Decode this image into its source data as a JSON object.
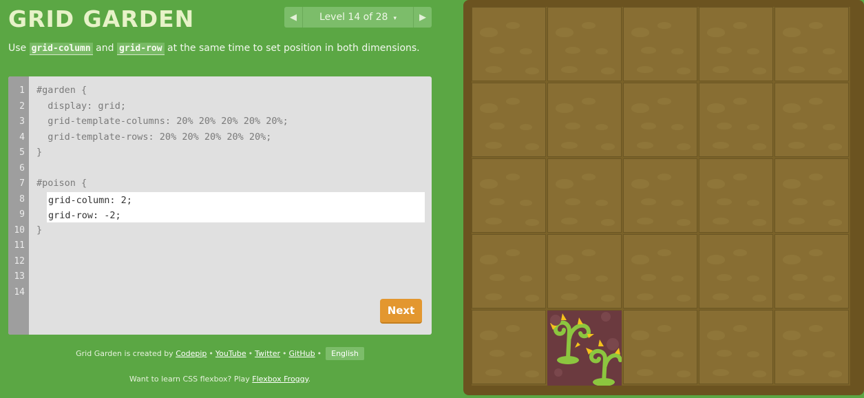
{
  "app": {
    "title": "GRID GARDEN"
  },
  "level_nav": {
    "prev_icon": "triangle-left-icon",
    "next_icon": "triangle-right-icon",
    "indicator": "Level 14 of 28",
    "caret": "▾"
  },
  "instructions": {
    "prefix": "Use ",
    "code1": "grid-column",
    "middle": " and ",
    "code2": "grid-row",
    "suffix": " at the same time to set position in both dimensions."
  },
  "editor": {
    "line_numbers": [
      "1",
      "2",
      "3",
      "4",
      "5",
      "6",
      "7",
      "8",
      "9",
      "10",
      "11",
      "12",
      "13",
      "14"
    ],
    "code": {
      "l1": "#garden {",
      "l2": "  display: grid;",
      "l3": "  grid-template-columns: 20% 20% 20% 20% 20%;",
      "l4": "  grid-template-rows: 20% 20% 20% 20% 20%;",
      "l5": "}",
      "l7": "#poison {",
      "l10": "}"
    },
    "input_value": "grid-column: 2;\ngrid-row: -2;",
    "next_label": "Next"
  },
  "footer": {
    "created_by": "Grid Garden is created by",
    "links": [
      "Codepip",
      "YouTube",
      "Twitter",
      "GitHub"
    ],
    "sep": "•",
    "language": "English",
    "promo_prefix": "Want to learn CSS flexbox? Play ",
    "promo_link": "Flexbox Froggy",
    "promo_suffix": "."
  },
  "garden": {
    "columns": 5,
    "rows": 5,
    "poison": {
      "column": 2,
      "row": 5
    },
    "colors": {
      "soil": "#886e33",
      "frame": "#6b5320",
      "poison_bg": "#6b3a3f",
      "weed": "#8cc63f",
      "thorn": "#f5c21b"
    }
  }
}
